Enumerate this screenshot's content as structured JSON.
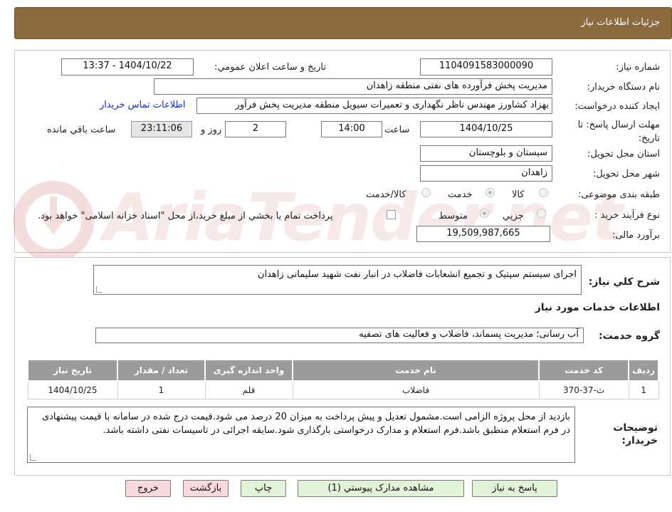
{
  "header": {
    "title": "جزئیات اطلاعات نیاز"
  },
  "form": {
    "need_number_label": "شماره نیاز:",
    "need_number": "1104091583000090",
    "announce_label": "تاریخ و ساعت اعلان عمومي:",
    "announce_value": "1404/10/22 - 13:37",
    "buyer_org_label": "نام دستگاه خريدار:",
    "buyer_org": "مديريت پخش فرآورده هاى نفتى منطقه زاهدان",
    "creator_label": "ايجاد کننده درخواست:",
    "creator": "بهزاد کشاورز مهندس ناظر نگهداری و تعمیرات سیویل منطقه  مدیریت پخش فرآور",
    "contact_link": "اطلاعات تماس خريدار",
    "deadline_label": "مهلت ارسال پاسخ: تا تاريخ:",
    "deadline_date": "1404/10/25",
    "time_label": "ساعت",
    "deadline_time": "14:00",
    "days_value": "2",
    "days_label": "روز و",
    "remaining_value": "23:11:06",
    "remaining_label": "ساعت باقي مانده",
    "province_label": "استان محل تحويل:",
    "province": "سیستان و بلوچستان",
    "city_label": "شهر محل تحويل:",
    "city": "زاهدان",
    "category_label": "طبقه بندی موضوعی:",
    "category_options": [
      "کالا",
      "خدمت",
      "کالا/خدمت"
    ],
    "category_selected": "خدمت",
    "process_label": "نوع فرآيند خريد :",
    "process_options": [
      "جزيي",
      "متوسط"
    ],
    "process_selected": "متوسط",
    "payment_note": "پرداخت تمام يا بخشي از مبلغ خريد،از محل \"اسناد خزانه اسلامی\" خواهد بود.",
    "budget_label": "برآورد مالی:",
    "budget": "19,509,987,665"
  },
  "details": {
    "summary_label": "شرح کلي نياز:",
    "summary": "اجرای سیستم سپتیک و تجمیع انشعابات فاضلاب در انبار نفت شهید سلیمانی زاهدان",
    "services_title": "اطلاعات خدمات مورد نياز",
    "service_group_label": "گروه خدمت:",
    "service_group": "آب رسانی؛ مديريت پسماند، فاضلاب و فعاليت های تصفيه",
    "table": {
      "headers": [
        "رديف",
        "کد خدمت",
        "نام خدمت",
        "واحد اندازه گيری",
        "تعداد / مقدار",
        "تاريخ نياز"
      ],
      "rows": [
        [
          "1",
          "ث-37-370",
          "فاضلاب",
          "قلم",
          "1",
          "1404/10/25"
        ]
      ]
    },
    "notes_label": "توضيحات خريدار:",
    "notes": "بازدید از محل پروژه الزامی است.مشمول تعدیل و پیش پرداخت به میزان 20 درصد می شود.قیمت درج شده در سامانه با قیمت پیشنهادی در فرم استعلام منطبق باشد.فرم استعلام و مدارک درخواستی بارگذاری شود.سابقه اجرائی در تاسیسات نفتی داشته باشد."
  },
  "buttons": {
    "reply": "پاسخ به نياز",
    "attachments": "مشاهده مدارک پيوستي (1)",
    "print": "چاپ",
    "back": "بازگشت",
    "exit": "خروج"
  },
  "watermark": {
    "text": "AriaTender.net"
  },
  "colors": {
    "header_bg": "#8b6a3e",
    "link": "#1a2ccd",
    "table_header": "#9b9b9b",
    "btn_green": "#e2f4d7",
    "btn_pink": "#f9d9de"
  }
}
